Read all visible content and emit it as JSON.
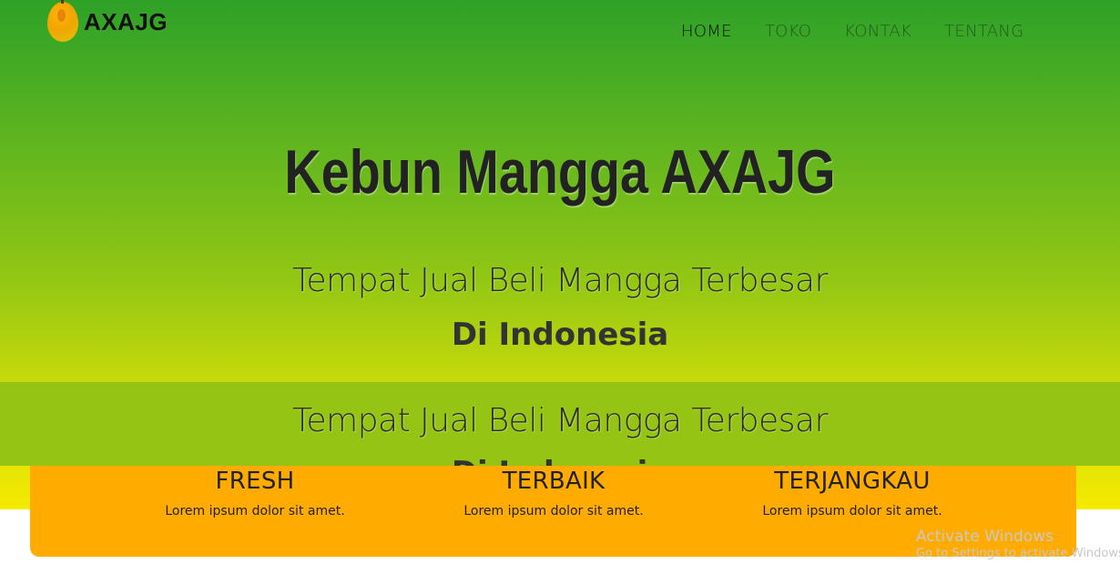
{
  "brand": {
    "name": "AXAJG"
  },
  "nav": {
    "items": [
      "HOME",
      "TOKO",
      "KONTAK",
      "TENTANG"
    ]
  },
  "hero": {
    "title": "Kebun Mangga AXAJG",
    "subtitle": "Tempat Jual Beli Mangga Terbesar",
    "subtitle_strong": "Di Indonesia"
  },
  "features": [
    {
      "title": "FRESH",
      "desc": "Lorem ipsum dolor sit amet."
    },
    {
      "title": "TERBAIK",
      "desc": "Lorem ipsum dolor sit amet."
    },
    {
      "title": "TERJANGKAU",
      "desc": "Lorem ipsum dolor sit amet."
    }
  ],
  "watermark": {
    "title": "Activate Windows",
    "subtitle": "Go to Settings to activate Windows."
  },
  "colors": {
    "accent": "#ffab00",
    "hero_top": "#2ea128",
    "hero_bottom": "#f4ea00"
  }
}
